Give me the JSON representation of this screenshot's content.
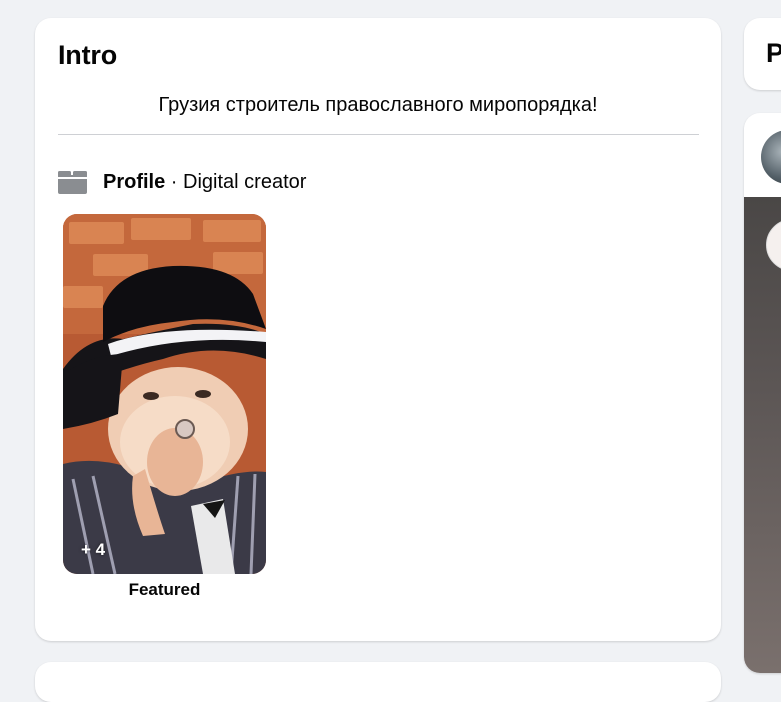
{
  "intro": {
    "title": "Intro",
    "bio": "Грузия строитель православного миропорядка!",
    "profile_label": "Profile",
    "category_separator": " · ",
    "category": "Digital creator",
    "featured": {
      "count_label": "+ 4",
      "label": "Featured"
    }
  },
  "right_column": {
    "top_card_title_fragment": "P"
  },
  "icons": {
    "category": "category-icon"
  }
}
